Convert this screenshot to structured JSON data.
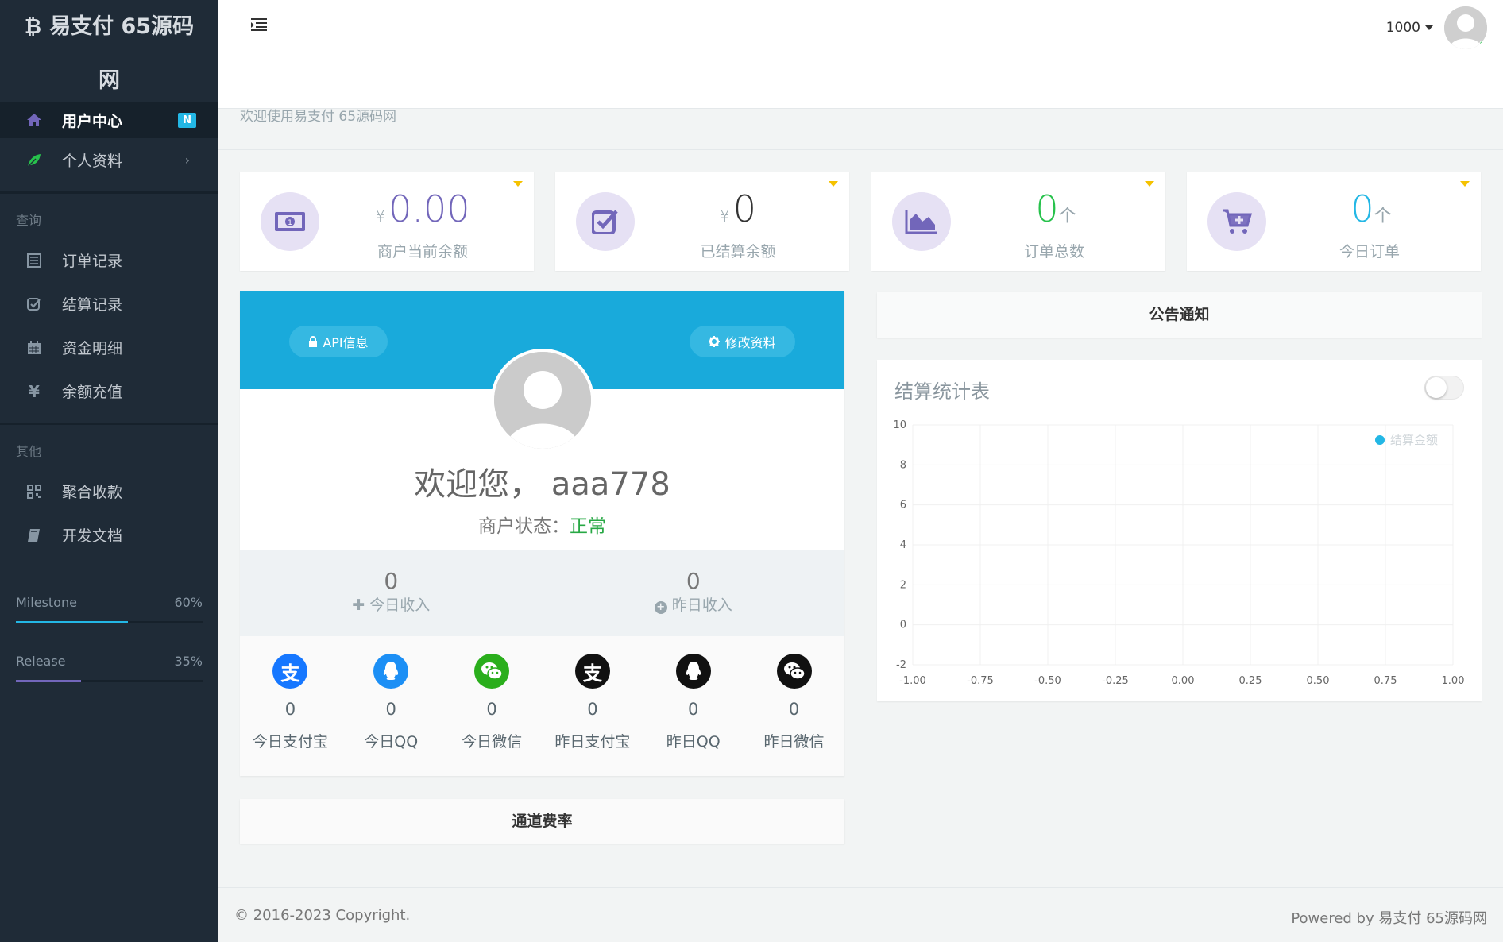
{
  "sidebar": {
    "brand_line1": "易支付 65源码",
    "brand_line2": "网",
    "items": [
      {
        "label": "用户中心",
        "badge": "N"
      },
      {
        "label": "个人资料",
        "arrow": "›"
      }
    ],
    "section_query": "查询",
    "query_items": [
      {
        "label": "订单记录"
      },
      {
        "label": "结算记录"
      },
      {
        "label": "资金明细"
      },
      {
        "label": "余额充值"
      }
    ],
    "section_other": "其他",
    "other_items": [
      {
        "label": "聚合收款"
      },
      {
        "label": "开发文档"
      }
    ],
    "progress": [
      {
        "label": "Milestone",
        "percent_text": "60%",
        "value": 60,
        "color": "#23b7e5"
      },
      {
        "label": "Release",
        "percent_text": "35%",
        "value": 35,
        "color": "#7266ba"
      }
    ]
  },
  "header": {
    "balance_label": "1000"
  },
  "welcome_text": "欢迎使用易支付 65源码网",
  "stats": [
    {
      "prefix": "¥",
      "value": "0.00",
      "suffix": "",
      "label": "商户当前余额",
      "color": "#7266ba"
    },
    {
      "prefix": "¥",
      "value": "0",
      "suffix": "",
      "label": "已结算余额",
      "color": "#333333"
    },
    {
      "prefix": "",
      "value": "0",
      "suffix": "个",
      "label": "订单总数",
      "color": "#27c24c"
    },
    {
      "prefix": "",
      "value": "0",
      "suffix": "个",
      "label": "今日订单",
      "color": "#23b7e5"
    }
  ],
  "profile": {
    "api_button": "API信息",
    "edit_button": "修改资料",
    "greeting": "欢迎您，  aaa778",
    "status_label": "商户状态：",
    "status_value": "正常",
    "today_income_value": "0",
    "today_income_label": "今日收入",
    "yesterday_income_value": "0",
    "yesterday_income_label": "昨日收入",
    "payments": [
      {
        "value": "0",
        "label": "今日支付宝"
      },
      {
        "value": "0",
        "label": "今日QQ"
      },
      {
        "value": "0",
        "label": "今日微信"
      },
      {
        "value": "0",
        "label": "昨日支付宝"
      },
      {
        "value": "0",
        "label": "昨日QQ"
      },
      {
        "value": "0",
        "label": "昨日微信"
      }
    ]
  },
  "channel_title": "通道费率",
  "notice_title": "公告通知",
  "chart_data": {
    "type": "line",
    "title": "结算统计表",
    "series": [
      {
        "name": "结算金额",
        "values": []
      }
    ],
    "x_ticks": [
      "-1.00",
      "-0.75",
      "-0.50",
      "-0.25",
      "0.00",
      "0.25",
      "0.50",
      "0.75",
      "1.00"
    ],
    "y_ticks": [
      "10",
      "8",
      "6",
      "4",
      "2",
      "0",
      "-2"
    ],
    "xlim": [
      -1,
      1
    ],
    "ylim": [
      -2,
      10
    ],
    "grid": true,
    "legend_placement": "top-right",
    "series_color": "#23b7e5"
  },
  "footer": {
    "copyright": "© 2016-2023 Copyright.",
    "powered": "Powered by 易支付 65源码网"
  }
}
